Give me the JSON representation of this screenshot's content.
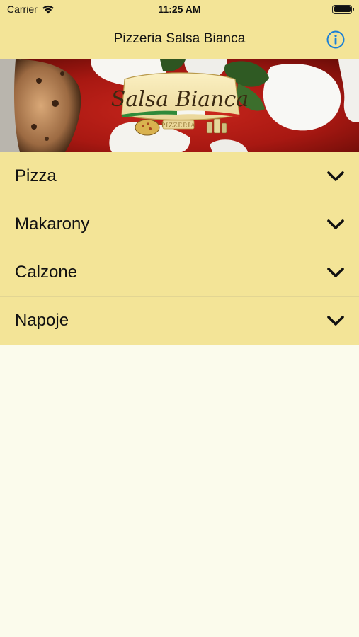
{
  "status_bar": {
    "carrier": "Carrier",
    "time": "11:25 AM"
  },
  "nav": {
    "title": "Pizzeria Salsa Bianca",
    "info_icon": "info-circle-icon"
  },
  "banner": {
    "logo_text": "Salsa Bianca",
    "logo_subtext": "PIZZERIA"
  },
  "menu": {
    "items": [
      {
        "label": "Pizza"
      },
      {
        "label": "Makarony"
      },
      {
        "label": "Calzone"
      },
      {
        "label": "Napoje"
      }
    ]
  },
  "colors": {
    "bar_background": "#f3e497",
    "page_background": "#fbfbec",
    "accent_blue": "#1a7fd6"
  }
}
